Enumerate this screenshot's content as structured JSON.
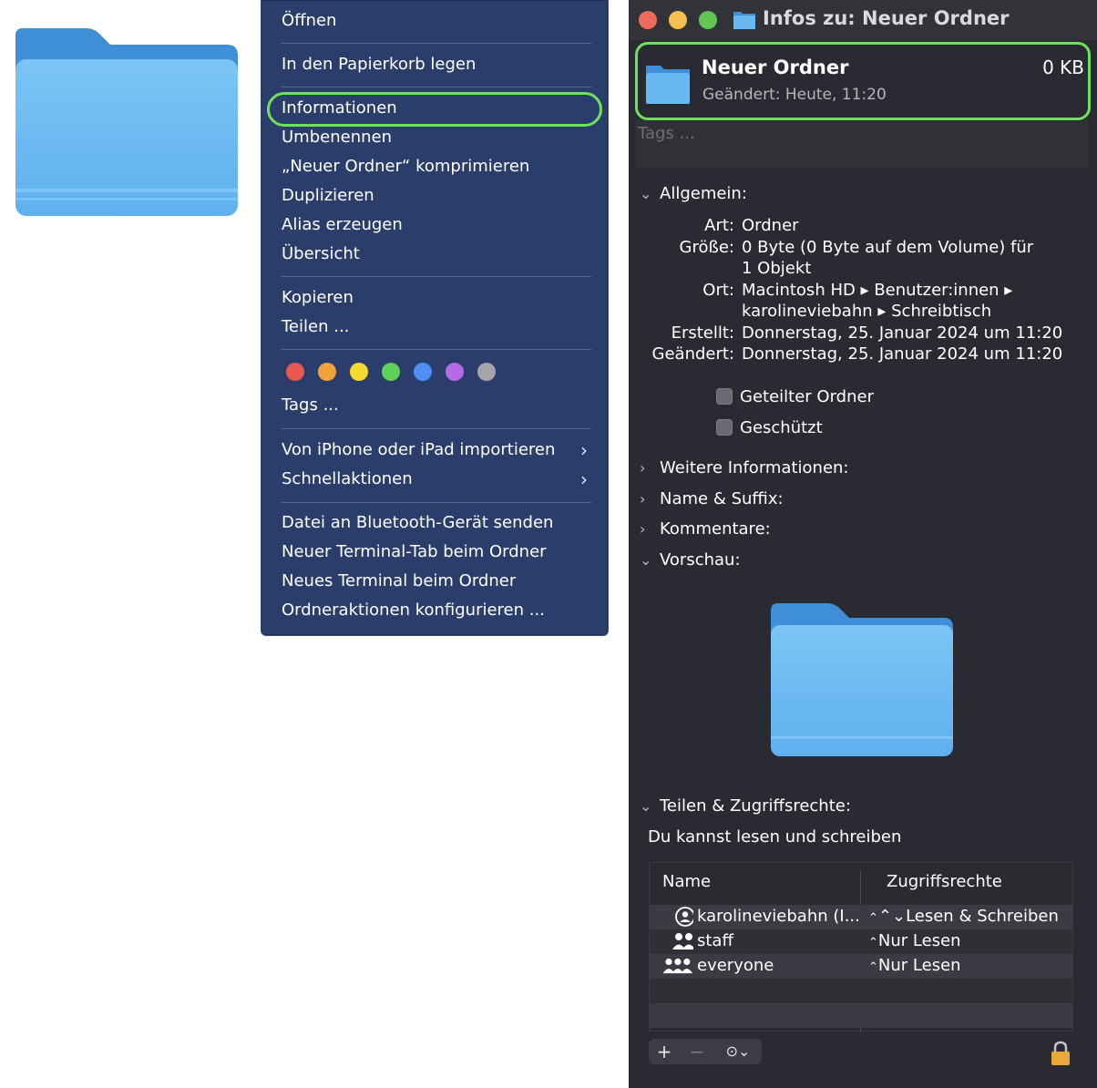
{
  "context_menu": {
    "items": [
      {
        "label": "Öffnen"
      },
      {
        "label": "In den Papierkorb legen"
      },
      {
        "label": "Informationen"
      },
      {
        "label": "Umbenennen"
      },
      {
        "label": "„Neuer Ordner“ komprimieren"
      },
      {
        "label": "Duplizieren"
      },
      {
        "label": "Alias erzeugen"
      },
      {
        "label": "Übersicht"
      },
      {
        "label": "Kopieren"
      },
      {
        "label": "Teilen ..."
      },
      {
        "label": "Tags ..."
      },
      {
        "label": "Von iPhone oder iPad importieren"
      },
      {
        "label": "Schnellaktionen"
      },
      {
        "label": "Datei an Bluetooth-Gerät senden"
      },
      {
        "label": "Neuer Terminal-Tab beim Ordner"
      },
      {
        "label": "Neues Terminal beim Ordner"
      },
      {
        "label": "Ordneraktionen konfigurieren ..."
      }
    ],
    "tag_colors": [
      "#e8594f",
      "#f0a33a",
      "#f3d931",
      "#5fcf58",
      "#4f8ef2",
      "#b56ae6",
      "#a4a4aa"
    ],
    "highlight_color": "#6ee25c"
  },
  "window": {
    "title": "Infos zu: Neuer Ordner",
    "name": "Neuer Ordner",
    "size": "0 KB",
    "modified": "Geändert: Heute, 11:20",
    "tags_placeholder": "Tags ...",
    "sections": {
      "general": "Allgemein:",
      "more_info": "Weitere Informationen:",
      "name_suffix": "Name & Suffix:",
      "comments": "Kommentare:",
      "preview": "Vorschau:",
      "sharing": "Teilen & Zugriffsrechte:"
    },
    "general": {
      "kind_label": "Art:",
      "kind": "Ordner",
      "size_label": "Größe:",
      "size_line1": "0 Byte (0 Byte auf dem Volume) für",
      "size_line2": "1 Objekt",
      "where_label": "Ort:",
      "where_line1": "Macintosh HD ▸ Benutzer:innen ▸",
      "where_line2": "karolineviebahn ▸ Schreibtisch",
      "created_label": "Erstellt:",
      "created": "Donnerstag, 25. Januar 2024 um 11:20",
      "modified_label": "Geändert:",
      "modified": "Donnerstag, 25. Januar 2024 um 11:20",
      "shared_folder": "Geteilter Ordner",
      "locked": "Geschützt"
    },
    "permissions": {
      "summary": "Du kannst lesen und schreiben",
      "col_name": "Name",
      "col_priv": "Zugriffsrechte",
      "rows": [
        {
          "name": "karolineviebahn (I...",
          "priv": "⌃⌄Lesen & Schreiben",
          "icon": "user-icon"
        },
        {
          "name": "staff",
          "priv": "Nur Lesen",
          "icon": "group-icon"
        },
        {
          "name": "everyone",
          "priv": "Nur Lesen",
          "icon": "everyone-icon"
        }
      ]
    }
  }
}
